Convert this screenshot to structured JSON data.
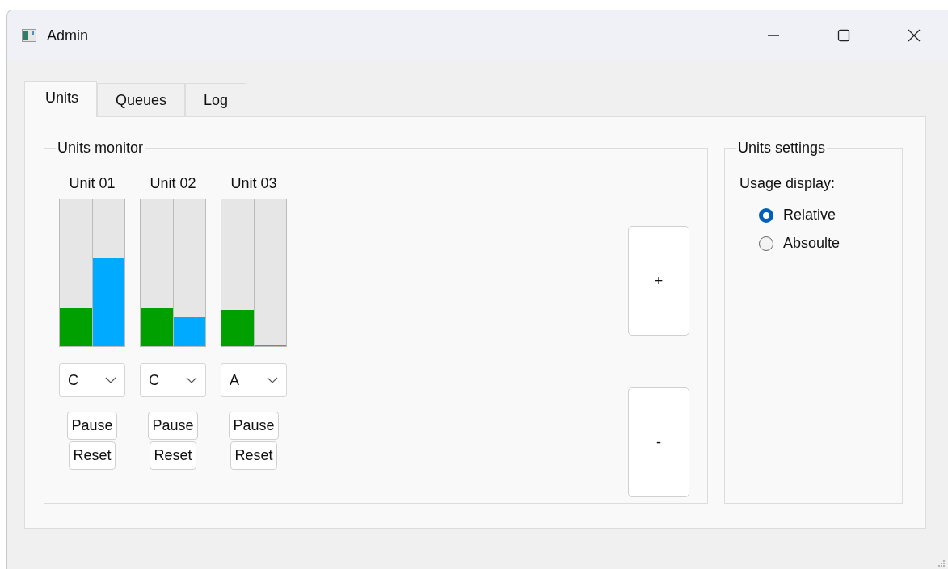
{
  "window": {
    "title": "Admin"
  },
  "tabs": [
    {
      "label": "Units",
      "selected": true
    },
    {
      "label": "Queues",
      "selected": false
    },
    {
      "label": "Log",
      "selected": false
    }
  ],
  "monitor": {
    "title": "Units monitor",
    "units": [
      {
        "name": "Unit 01",
        "meters": [
          {
            "level": 0.26
          },
          {
            "level": 0.6
          }
        ],
        "mode": "C",
        "pause": "Pause",
        "reset": "Reset"
      },
      {
        "name": "Unit 02",
        "meters": [
          {
            "level": 0.26
          },
          {
            "level": 0.2
          }
        ],
        "mode": "C",
        "pause": "Pause",
        "reset": "Reset"
      },
      {
        "name": "Unit 03",
        "meters": [
          {
            "level": 0.25
          },
          {
            "level": 0
          }
        ],
        "mode": "A",
        "pause": "Pause",
        "reset": "Reset"
      }
    ],
    "add_button": "+",
    "remove_button": "-"
  },
  "settings": {
    "title": "Units settings",
    "label": "Usage display:",
    "options": [
      {
        "label": "Relative",
        "selected": true
      },
      {
        "label": "Absoulte",
        "selected": false
      }
    ]
  }
}
